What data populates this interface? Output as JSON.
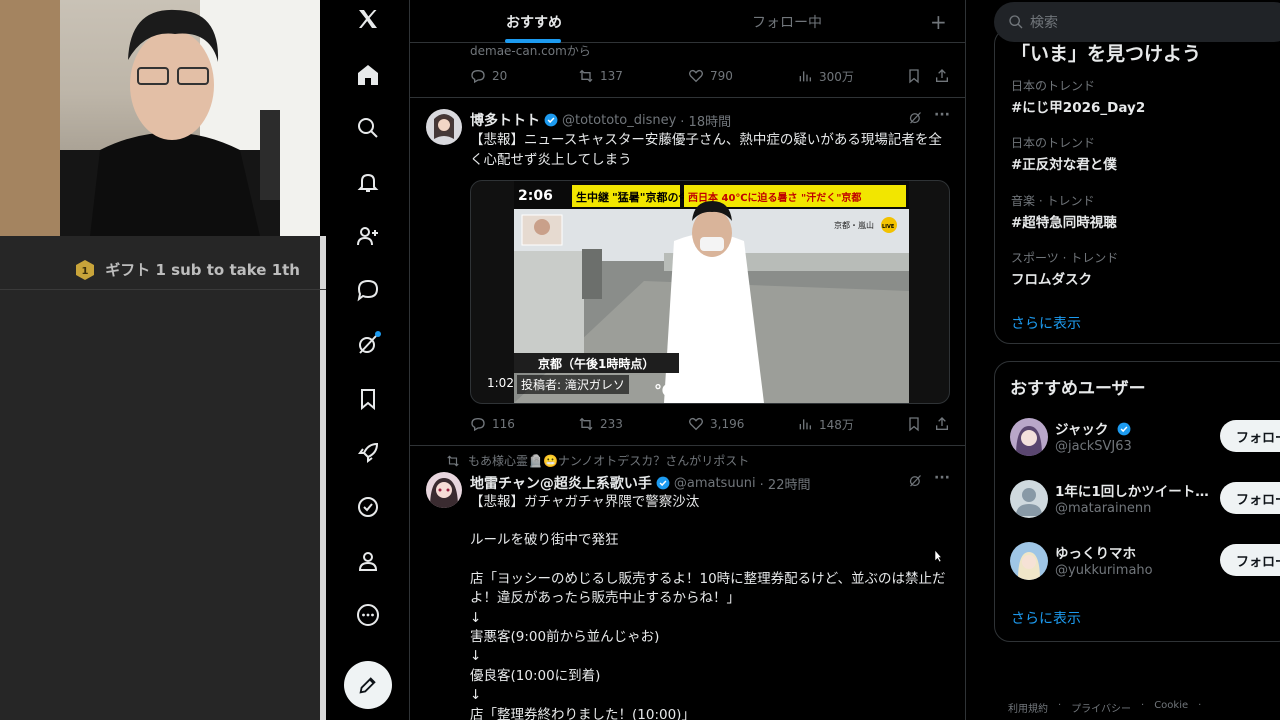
{
  "overlay": {
    "gift_text": "ギフト 1 sub to take 1th",
    "gift_badge_number": "1"
  },
  "nav": {
    "items": [
      "x-logo",
      "home",
      "explore",
      "notifications",
      "follow",
      "messages",
      "grok",
      "bookmarks",
      "launch",
      "verified",
      "profile",
      "more"
    ],
    "compose_icon": "compose-icon"
  },
  "feed": {
    "tabs": [
      {
        "label": "おすすめ",
        "active": true
      },
      {
        "label": "フォロー中",
        "active": false
      },
      {
        "label": "+"
      }
    ],
    "prev_post": {
      "source": "demae-can.comから",
      "replies": "20",
      "reposts": "137",
      "likes": "790",
      "views": "300万"
    },
    "post1": {
      "name": "博多トトト",
      "handle": "@totototo_disney",
      "time": "· 18時間",
      "text": "【悲報】ニュースキャスター安藤優子さん、熱中症の疑いがある現場記者を全く心配せず炎上してしまう",
      "video_duration": "1:02",
      "video_uploader": "投稿者: 滝沢ガレソ",
      "replies": "116",
      "reposts": "233",
      "likes": "3,196",
      "views": "148万",
      "video_overlay": {
        "time": "2:06",
        "headline_a": "生中継",
        "headline_b": "\"猛暑\"京都の今",
        "headline_c": "西日本 40℃に迫る暑さ \"汗だく\"京都",
        "location": "京都・嵐山",
        "live": "LIVE",
        "caption": "京都（午後1時時点）",
        "temp_unit": "℃"
      }
    },
    "post2": {
      "repost_by": "もあ様心霊🪦😬ナンノオトデスカ？さんがリポスト",
      "name": "地雷チャン@超炎上系歌い手",
      "handle": "@amatsuuni",
      "time": "· 22時間",
      "lines": [
        "【悲報】ガチャガチャ界隈で警察沙汰",
        "",
        "ルールを破り街中で発狂",
        "",
        "店「ヨッシーのめじるし販売するよ！10時に整理券配るけど、並ぶのは禁止だよ！違反があったら販売中止するからね！」",
        "↓",
        "害悪客(9:00前から並んじゃお)",
        "↓",
        "優良客(10:00に到着)",
        "↓",
        "店「整理券終わりました！(10:00)」"
      ]
    }
  },
  "sidebar": {
    "search_placeholder": "検索",
    "trends_title": "「いま」を見つけよう",
    "trends": [
      {
        "category": "日本のトレンド",
        "tag": "#にじ甲2026_Day2"
      },
      {
        "category": "日本のトレンド",
        "tag": "#正反対な君と僕"
      },
      {
        "category": "音楽 · トレンド",
        "tag": "#超特急同時視聴"
      },
      {
        "category": "スポーツ · トレンド",
        "tag": "フロムダスク"
      }
    ],
    "trends_more": "さらに表示",
    "wtf_title": "おすすめユーザー",
    "users": [
      {
        "name": "ジャック",
        "handle": "@jackSVJ63",
        "verified": true,
        "button": "フォロー"
      },
      {
        "name": "1年に1回しかツイート…",
        "handle": "@matarainenn",
        "verified": false,
        "button": "フォロー"
      },
      {
        "name": "ゆっくりマホ",
        "handle": "@yukkurimaho",
        "verified": false,
        "button": "フォロー"
      }
    ],
    "wtf_more": "さらに表示",
    "footer": [
      "利用規約",
      "·",
      "プライバシー",
      "·",
      "Cookie",
      "·"
    ]
  },
  "colors": {
    "accent": "#1d9bf0",
    "background": "#000000",
    "border": "#2f3336",
    "muted": "#71767b"
  }
}
